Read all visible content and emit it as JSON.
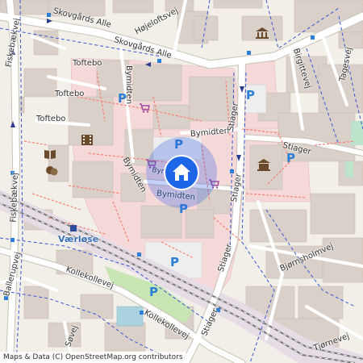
{
  "map": {
    "colors": {
      "background": "#f2efe9",
      "building": "#d9d0c9",
      "retail_area": "#f5d9d9",
      "parking": "#eeeeee",
      "road": "#ffffff",
      "road_casing": "#c8c2b8",
      "railway": "#777777",
      "railway_zone": "#e6dce6",
      "water": "#aad3df",
      "park": "#c8e6b4",
      "footpath": "#fa8072",
      "boundary_dashed": "#3a57d6",
      "accent_pin": "#1d66e8"
    },
    "labels": {
      "skovgards_1": "Skovgårds Alle",
      "skovgards_2": "Skovgårds Alle",
      "hojeloftsvej": "Højeloftsvej",
      "toftebo_1": "Toftebo",
      "toftebo_2": "Toftebo",
      "toftebo_3": "Toftebo",
      "bymidten_1": "Bymidten",
      "bymidten_2": "Bymidten",
      "bymidten_3": "Bymidten",
      "bymidten_4": "Bymidten",
      "bymidten_5": "Bymidten",
      "stiager_1": "Stiager",
      "stiager_2": "Stiager",
      "stiager_3": "Stiager",
      "stiager_4": "Stiager",
      "stiager_5": "Stiager",
      "fiskebaekvej_1": "Fiskebækvej",
      "fiskebaekvej_2": "Fiskebækvej",
      "ballerupvej": "Ballerupvej",
      "kollekollevej_1": "Kollekollevej",
      "kollekollevej_2": "Kollekollevej",
      "bjornsholmvej": "Bjørnsholmvej",
      "birgittevej": "Birgittevej",
      "tagesvej": "Tagesvej",
      "sovej": "Søvej",
      "tjorneveien": "Tjørnevej",
      "place_varlose": "Værløse",
      "parking_symbol": "P"
    },
    "icons": [
      "museum-icon",
      "book-icon",
      "theatre-icon",
      "cinema-icon",
      "shopping-cart-icon",
      "building-icon",
      "home-icon",
      "parking-icon"
    ],
    "attribution": "Maps & Data (C) OpenStreetMap.org contributors"
  }
}
